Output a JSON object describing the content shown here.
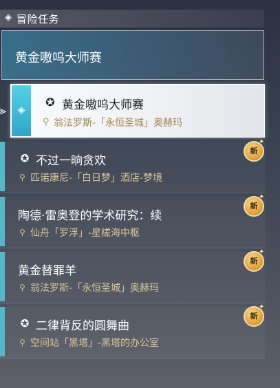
{
  "section": {
    "title": "冒险任务"
  },
  "banner": {
    "title": "黄金嗷呜大师赛"
  },
  "selected": {
    "title": "黄金嗷呜大师赛",
    "location": "翁法罗斯-「永恒圣城」奥赫玛"
  },
  "missions": [
    {
      "title": "不过一晌贪欢",
      "location": "匹诺康尼-「白日梦」酒店-梦境",
      "has_icon": true,
      "badge": "新"
    },
    {
      "title": "陶德·雷奥登的学术研究：续",
      "location": "仙舟「罗浮」-星槎海中枢",
      "has_icon": false,
      "badge": "新"
    },
    {
      "title": "黄金替罪羊",
      "location": "翁法罗斯-「永恒圣城」奥赫玛",
      "has_icon": false,
      "badge": "新"
    },
    {
      "title": "二律背反的圆舞曲",
      "location": "空间站「黑塔」-黑塔的办公室",
      "has_icon": true,
      "badge": "新"
    }
  ],
  "icons": {
    "section": "diamond-icon",
    "mission_type": "mission-type-icon",
    "location": "location-pin-icon",
    "new": "new-badge"
  },
  "colors": {
    "accent": "#58b6c9",
    "location_text": "#dcc799",
    "badge": "#e6a944"
  }
}
